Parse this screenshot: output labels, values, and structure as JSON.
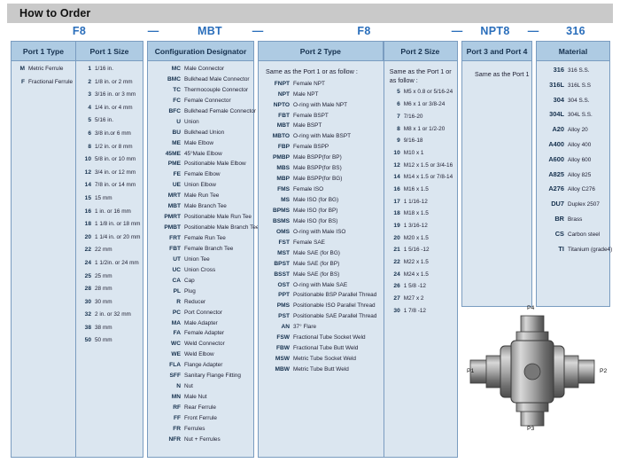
{
  "header": {
    "title": "How to Order"
  },
  "part_number": {
    "segments": [
      "F8",
      "MBT",
      "F8",
      "NPT8",
      "316"
    ],
    "separator": "—"
  },
  "columns": {
    "port1_type": {
      "header": "Port 1 Type",
      "items": [
        {
          "code": "M",
          "desc": "Metric Ferrule"
        },
        {
          "code": "F",
          "desc": "Fractional Ferrule"
        }
      ]
    },
    "port1_size": {
      "header": "Port 1 Size",
      "items": [
        {
          "code": "1",
          "desc": "1/16 in."
        },
        {
          "code": "2",
          "desc": "1/8 in. or 2 mm"
        },
        {
          "code": "3",
          "desc": "3/16 in. or 3 mm"
        },
        {
          "code": "4",
          "desc": "1/4 in. or 4 mm"
        },
        {
          "code": "5",
          "desc": "5/16 in."
        },
        {
          "code": "6",
          "desc": "3/8 in.or 6 mm"
        },
        {
          "code": "8",
          "desc": "1/2 in. or 8 mm"
        },
        {
          "code": "10",
          "desc": "5/8 in. or 10 mm"
        },
        {
          "code": "12",
          "desc": "3/4 in. or 12 mm"
        },
        {
          "code": "14",
          "desc": "7/8 in. or 14 mm"
        },
        {
          "code": "15",
          "desc": "15 mm"
        },
        {
          "code": "16",
          "desc": "1 in. or 16 mm"
        },
        {
          "code": "18",
          "desc": "1 1/8 in. or 18 mm"
        },
        {
          "code": "20",
          "desc": "1 1/4 in. or 20 mm"
        },
        {
          "code": "22",
          "desc": "22 mm"
        },
        {
          "code": "24",
          "desc": "1 1/2in. or 24 mm"
        },
        {
          "code": "25",
          "desc": "25 mm"
        },
        {
          "code": "28",
          "desc": "28 mm"
        },
        {
          "code": "30",
          "desc": "30 mm"
        },
        {
          "code": "32",
          "desc": "2 in. or 32 mm"
        },
        {
          "code": "38",
          "desc": "38 mm"
        },
        {
          "code": "50",
          "desc": "50 mm"
        }
      ]
    },
    "configuration_designator": {
      "header": "Configuration Designator",
      "items": [
        {
          "code": "MC",
          "desc": "Male Connector"
        },
        {
          "code": "BMC",
          "desc": "Bulkhead Male Connector"
        },
        {
          "code": "TC",
          "desc": "Thermocouple Connector"
        },
        {
          "code": "FC",
          "desc": "Female Connector"
        },
        {
          "code": "BFC",
          "desc": "Bulkhead Female Connector"
        },
        {
          "code": "U",
          "desc": "Union"
        },
        {
          "code": "BU",
          "desc": "Bulkhead Union"
        },
        {
          "code": "ME",
          "desc": "Male Elbow"
        },
        {
          "code": "45ME",
          "desc": "45°Male Elbow"
        },
        {
          "code": "PME",
          "desc": "Positionable Male Elbow"
        },
        {
          "code": "FE",
          "desc": "Female Elbow"
        },
        {
          "code": "UE",
          "desc": "Union Elbow"
        },
        {
          "code": "MRT",
          "desc": "Male Run Tee"
        },
        {
          "code": "MBT",
          "desc": "Male Branch Tee"
        },
        {
          "code": "PMRT",
          "desc": "Positionable Male Run Tee"
        },
        {
          "code": "PMBT",
          "desc": "Positionable Male Branch Tee"
        },
        {
          "code": "FRT",
          "desc": "Female Run Tee"
        },
        {
          "code": "FBT",
          "desc": "Female Branch Tee"
        },
        {
          "code": "UT",
          "desc": "Union Tee"
        },
        {
          "code": "UC",
          "desc": "Union Cross"
        },
        {
          "code": "CA",
          "desc": "Cap"
        },
        {
          "code": "PL",
          "desc": "Plug"
        },
        {
          "code": "R",
          "desc": "Reducer"
        },
        {
          "code": "PC",
          "desc": "Port Connector"
        },
        {
          "code": "MA",
          "desc": "Male Adapter"
        },
        {
          "code": "FA",
          "desc": "Female Adapter"
        },
        {
          "code": "WC",
          "desc": "Weld Connector"
        },
        {
          "code": "WE",
          "desc": "Weld Elbow"
        },
        {
          "code": "FLA",
          "desc": "Flange Adapter"
        },
        {
          "code": "SFF",
          "desc": "Sanitary Flange Fitting"
        },
        {
          "code": "N",
          "desc": "Nut"
        },
        {
          "code": "MN",
          "desc": "Male Nut"
        },
        {
          "code": "RF",
          "desc": "Rear Ferrule"
        },
        {
          "code": "FF",
          "desc": "Front Ferrule"
        },
        {
          "code": "FR",
          "desc": "Ferrules"
        },
        {
          "code": "NFR",
          "desc": "Nut + Ferrules"
        }
      ]
    },
    "port2_type": {
      "header": "Port 2 Type",
      "note": "Same as the Port 1 or as follow :",
      "items": [
        {
          "code": "FNPT",
          "desc": "Female NPT"
        },
        {
          "code": "NPT",
          "desc": "Male NPT"
        },
        {
          "code": "NPTO",
          "desc": "O-ring with Male NPT"
        },
        {
          "code": "FBT",
          "desc": "Female BSPT"
        },
        {
          "code": "MBT",
          "desc": "Male BSPT"
        },
        {
          "code": "MBTO",
          "desc": "O-ring with Male BSPT"
        },
        {
          "code": "FBP",
          "desc": "Female BSPP"
        },
        {
          "code": "PMBP",
          "desc": "Male BSPP(for BP)"
        },
        {
          "code": "MBS",
          "desc": "Male BSPP(for BS)"
        },
        {
          "code": "MBP",
          "desc": "Male BSPP(for BG)"
        },
        {
          "code": "FMS",
          "desc": "Female ISO"
        },
        {
          "code": "MS",
          "desc": "Male ISO (for BG)"
        },
        {
          "code": "BPMS",
          "desc": "Male ISO (for BP)"
        },
        {
          "code": "BSMS",
          "desc": "Male ISO (for BS)"
        },
        {
          "code": "OMS",
          "desc": "O-ring with Male ISO"
        },
        {
          "code": "FST",
          "desc": "Female SAE"
        },
        {
          "code": "MST",
          "desc": "Male SAE (for BG)"
        },
        {
          "code": "BPST",
          "desc": "Male SAE (for BP)"
        },
        {
          "code": "BSST",
          "desc": "Male SAE (for BS)"
        },
        {
          "code": "OST",
          "desc": "O-ring with Male SAE"
        },
        {
          "code": "PPT",
          "desc": "Positionable BSP Parallel Thread"
        },
        {
          "code": "PMS",
          "desc": "Positionable ISO Parallel Thread"
        },
        {
          "code": "PST",
          "desc": "Positionable SAE Parallel Thread"
        },
        {
          "code": "AN",
          "desc": "37° Flare"
        },
        {
          "code": "FSW",
          "desc": "Fractional Tube Socket Weld"
        },
        {
          "code": "FBW",
          "desc": "Fractional Tube Butt Weld"
        },
        {
          "code": "MSW",
          "desc": "Metric Tube Socket Weld"
        },
        {
          "code": "MBW",
          "desc": "Metric Tube Butt Weld"
        }
      ]
    },
    "port2_size": {
      "header": "Port 2 Size",
      "note": "Same as the Port 1 or as follow :",
      "items": [
        {
          "code": "5",
          "desc": "M5 x 0.8 or 5/16-24"
        },
        {
          "code": "6",
          "desc": "M6 x 1 or 3/8-24"
        },
        {
          "code": "7",
          "desc": "7/16-20"
        },
        {
          "code": "8",
          "desc": "M8 x 1 or 1/2-20"
        },
        {
          "code": "9",
          "desc": "9/16-18"
        },
        {
          "code": "10",
          "desc": "M10 x 1"
        },
        {
          "code": "12",
          "desc": "M12 x 1.5 or 3/4-16"
        },
        {
          "code": "14",
          "desc": "M14 x 1.5 or 7/8-14"
        },
        {
          "code": "16",
          "desc": "M16 x 1.5"
        },
        {
          "code": "17",
          "desc": "1 1/16-12"
        },
        {
          "code": "18",
          "desc": "M18 x 1.5"
        },
        {
          "code": "19",
          "desc": "1 3/16-12"
        },
        {
          "code": "20",
          "desc": "M20 x 1.5"
        },
        {
          "code": "21",
          "desc": "1 5/16 -12"
        },
        {
          "code": "22",
          "desc": "M22 x 1.5"
        },
        {
          "code": "24",
          "desc": "M24 x 1.5"
        },
        {
          "code": "26",
          "desc": "1 5/8 -12"
        },
        {
          "code": "27",
          "desc": "M27 x 2"
        },
        {
          "code": "30",
          "desc": "1 7/8 -12"
        }
      ]
    },
    "port3_port4": {
      "header": "Port 3 and Port 4",
      "note": "Same as the Port 1"
    },
    "material": {
      "header": "Material",
      "items": [
        {
          "code": "316",
          "desc": "316 S.S."
        },
        {
          "code": "316L",
          "desc": "316L S.S"
        },
        {
          "code": "304",
          "desc": "304 S.S."
        },
        {
          "code": "304L",
          "desc": "304L S.S."
        },
        {
          "code": "A20",
          "desc": "Alloy 20"
        },
        {
          "code": "A400",
          "desc": "Alloy 400"
        },
        {
          "code": "A600",
          "desc": "Alloy 600"
        },
        {
          "code": "A825",
          "desc": "Alloy 825"
        },
        {
          "code": "A276",
          "desc": "Alloy C276"
        },
        {
          "code": "DU7",
          "desc": "Duplex 2507"
        },
        {
          "code": "BR",
          "desc": "Brass"
        },
        {
          "code": "CS",
          "desc": "Carbon steel"
        },
        {
          "code": "TI",
          "desc": "Titanium (grade4)"
        }
      ]
    }
  },
  "diagram": {
    "labels": {
      "p1": "P1",
      "p2": "P2",
      "p3": "P3",
      "p4": "P4"
    }
  },
  "colors": {
    "header_bar": "#c9c9c9",
    "table_body": "#dbe6f0",
    "column_header": "#aecbe3",
    "border": "#7a9cc0",
    "part_number": "#2a6ebb"
  }
}
